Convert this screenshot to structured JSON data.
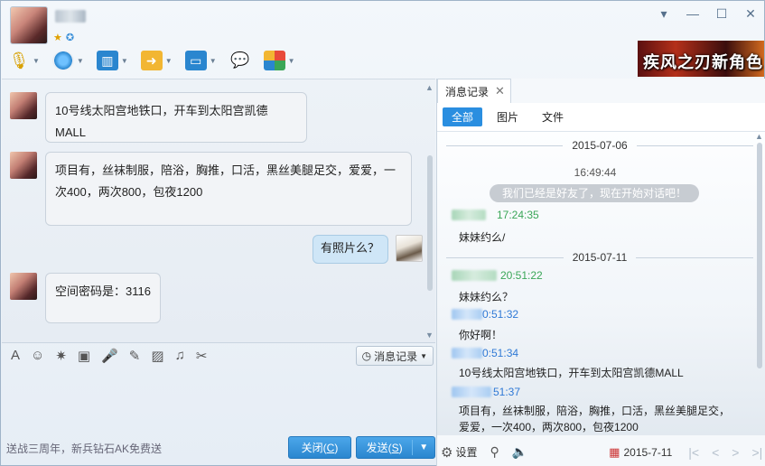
{
  "window": {
    "minimize": "▾",
    "restore": "—",
    "maximize": "☐",
    "close": "✕"
  },
  "banner": {
    "text": "疾风之刃新角色"
  },
  "chat": {
    "messages": [
      {
        "from": "other",
        "text": "10号线太阳宫地铁口，开车到太阳宫凯德MALL"
      },
      {
        "from": "other",
        "text_line1": "项目有，丝袜制服，陪浴，胸推，口活，黑丝美腿足交，爱爱，一",
        "text_line2": "次400，两次800，包夜1200"
      },
      {
        "from": "me",
        "text": "有照片么？"
      },
      {
        "from": "other",
        "text": "空间密码是：3116"
      }
    ]
  },
  "input_toolbar": {
    "history_label": "消息记录"
  },
  "footer": {
    "ad": "送战三周年，新兵钻石AK免费送",
    "close_prefix": "关闭(",
    "close_key": "C",
    "close_suffix": ")",
    "send_prefix": "发送(",
    "send_key": "S",
    "send_suffix": ")"
  },
  "history": {
    "tab_label": "消息记录",
    "filters": [
      "全部",
      "图片",
      "文件"
    ],
    "entries": {
      "date1": "2015-07-06",
      "time1": "16:49:44",
      "system_msg": "我们已经是好友了，现在开始对话吧！",
      "t1": "17:24:35",
      "m1": "妹妹约么/",
      "date2": "2015-07-11",
      "t2": "20:51:22",
      "m2": "妹妹约么？",
      "t3": "0:51:32",
      "m3": "你好啊！",
      "t4": "0:51:34",
      "m4": "10号线太阳宫地铁口，开车到太阳宫凯德MALL",
      "t5": "51:37",
      "m5_line1": "项目有，丝袜制服，陪浴，胸推，口活，黑丝美腿足交，",
      "m5_line2": "爱爱，一次400，两次800，包夜1200"
    },
    "footer": {
      "settings": "设置",
      "date": "2015-7-11"
    }
  },
  "colors": {
    "accent": "#2a8ee0",
    "green_sender": "#3aa657",
    "blue_sender": "#2f79d6"
  }
}
